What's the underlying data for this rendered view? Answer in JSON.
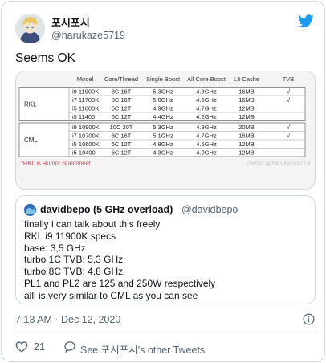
{
  "tweet": {
    "display_name": "포시포시",
    "handle": "@harukaze5719",
    "text": "Seems OK",
    "timestamp": "7:13 AM · Dec 12, 2020",
    "likes": "21",
    "reply_label": "See 포시포시's other Tweets"
  },
  "spec_table": {
    "headers": [
      "Model",
      "Core/Thread",
      "Single Boost",
      "All Core Boost",
      "L3 Cache",
      "TVB"
    ],
    "groups": [
      {
        "label": "RKL",
        "rows": [
          [
            "i9 11900K",
            "8C 16T",
            "5.3GHz",
            "4.8GHz",
            "16MB",
            "√"
          ],
          [
            "i7 11700K",
            "8C 16T",
            "5.0GHz",
            "4.6GHz",
            "16MB",
            "√"
          ],
          [
            "i5 11600K",
            "6C 12T",
            "4.9GHz",
            "4.7GHz",
            "12MB",
            ""
          ],
          [
            "i5 11400",
            "6C 12T",
            "4.4GHz",
            "4.2GHz",
            "12MB",
            ""
          ]
        ]
      },
      {
        "label": "CML",
        "rows": [
          [
            "i9 10900K",
            "10C 20T",
            "5.3GHz",
            "4.9GHz",
            "20MB",
            "√"
          ],
          [
            "i7 10700K",
            "8C 16T",
            "5.1GHz",
            "4.7GHz",
            "16MB",
            "√"
          ],
          [
            "i5 10600K",
            "6C 12T",
            "4.8GHz",
            "4.5GHz",
            "12MB",
            ""
          ],
          [
            "i5 10400",
            "6C 12T",
            "4.3GHz",
            "4.0GHz",
            "12MB",
            ""
          ]
        ]
      }
    ],
    "footnote": "*RKL is Rumor Specsheet",
    "watermark": "Twitter @harukaze5719",
    "footnote_color": "#e0393e"
  },
  "quote": {
    "display_name": "davidbepo (5 GHz overload)",
    "handle": "@davidbepo",
    "lines": [
      "finally i can talk about this freely",
      "RKL i9 11900K specs",
      "base: 3,5 GHz",
      "turbo 1C TVB: 5,3 GHz",
      "turbo 8C TVB: 4,8 GHz",
      "PL1 and PL2 are 125 and 250W respectively",
      "alll is very similar to CML as you can see"
    ]
  },
  "colors": {
    "accent": "#1d9bf0",
    "like": "#e0245e",
    "muted": "#536471"
  }
}
